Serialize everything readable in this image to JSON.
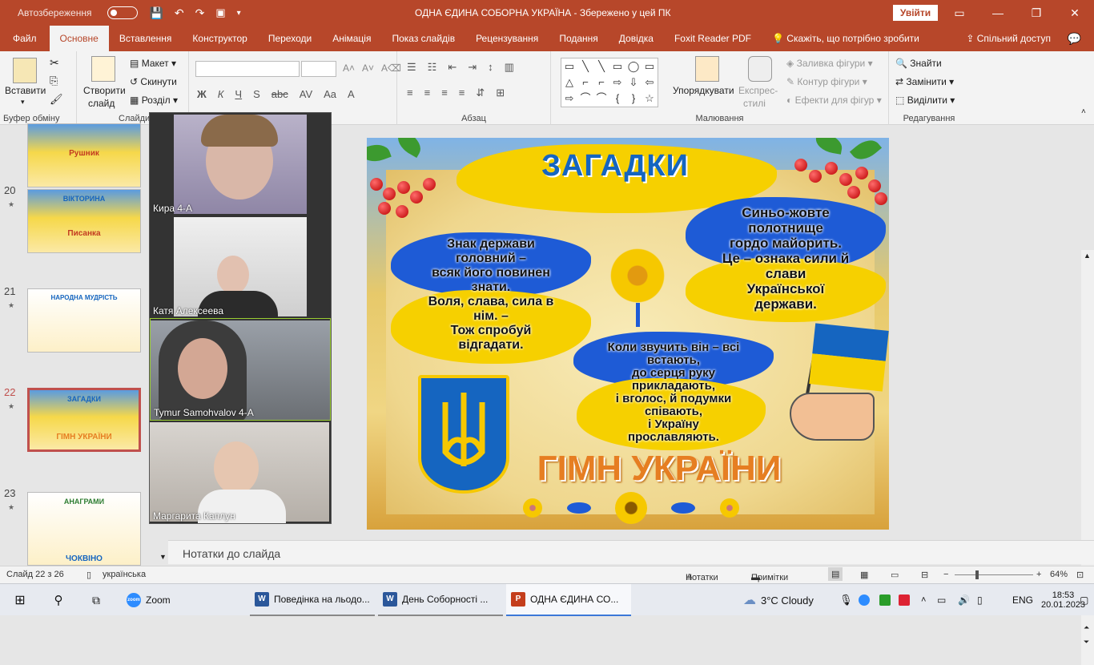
{
  "window": {
    "autosave": "Автозбереження",
    "title": "ОДНА ЄДИНА СОБОРНА УКРАЇНА  -  Збережено у цей ПК",
    "signin": "Увійти"
  },
  "tabs": [
    "Файл",
    "Основне",
    "Вставлення",
    "Конструктор",
    "Переходи",
    "Анімація",
    "Показ слайдів",
    "Рецензування",
    "Подання",
    "Довідка",
    "Foxit Reader PDF",
    "Скажіть, що потрібно зробити"
  ],
  "share": "Спільний доступ",
  "ribbon": {
    "paste": "Вставити",
    "clipboard": "Буфер обміну",
    "new_slide": "Створити",
    "new_slide2": "слайд",
    "layout": "Макет",
    "reset": "Скинути",
    "section": "Розділ",
    "slides": "Слайди",
    "paragraph": "Абзац",
    "arrange": "Упорядкувати",
    "styles": "Експрес-",
    "styles2": "стилі",
    "fill": "Заливка фігури",
    "outline": "Контур фігури",
    "effects": "Ефекти для фігур",
    "drawing": "Малювання",
    "find": "Знайти",
    "replace": "Замінити",
    "select": "Виділити",
    "editing": "Редагування",
    "bold": "Ж",
    "italic": "К",
    "underline": "Ч",
    "strike": "S",
    "abc": "abc",
    "av": "AV",
    "aa": "Aa",
    "fontcolor": "A",
    "shapes": [
      "▭",
      "╲",
      "╲",
      "▭",
      "◯",
      "▭",
      "△",
      "⌐",
      "⌐",
      "⇨",
      "⇩",
      "⇦",
      "⇨",
      "⌒",
      "⌒",
      "{",
      "}",
      "☆"
    ]
  },
  "thumbs": [
    {
      "num": "",
      "top_text": "",
      "bottom": "Рушник"
    },
    {
      "num": "20",
      "top_text": "ВІКТОРИНА",
      "bottom": "Писанка"
    },
    {
      "num": "21",
      "top_text": "НАРОДНА МУДРІСТЬ",
      "bottom": ""
    },
    {
      "num": "22",
      "top_text": "ЗАГАДКИ",
      "bottom": "ГІМН УКРАЇНИ"
    },
    {
      "num": "23",
      "top_text": "АНАГРАМИ",
      "bottom": "ЧОКВІНО"
    }
  ],
  "star": "★",
  "zoom": [
    "Кира 4-А",
    "Катя Алексеева",
    "Tymur Samohvalov 4-A",
    "Маргарита Каплун"
  ],
  "slide": {
    "title": "ЗАГАДКИ",
    "r1": [
      "Знак держави",
      "головний –",
      "всяк його повинен",
      "знати.",
      "Воля, слава, сила в",
      "нім. –",
      "Тож спробуй",
      "відгадати."
    ],
    "r2": [
      "Синьо-жовте",
      "полотнище",
      "гордо майорить.",
      "Це – ознака сили й",
      "слави",
      "Української",
      "держави."
    ],
    "r3": [
      "Коли звучить він – всі",
      "встають,",
      "до серця руку",
      "прикладають,",
      "і вголос, й подумки",
      "співають,",
      "і Україну",
      "прославляють."
    ],
    "hymn": "ГІМН УКРАЇНИ"
  },
  "notes": "Нотатки до слайда",
  "status": {
    "slide": "Слайд 22 з 26",
    "lang": "українська",
    "notes": "Нотатки",
    "comments": "Примітки",
    "zoom": "64%"
  },
  "taskbar": {
    "zoom": "Zoom",
    "w1": "Поведінка на льодо...",
    "w2": "День Соборності ...",
    "ppt": "ОДНА ЄДИНА СО...",
    "weather": "3°C  Cloudy",
    "lang": "ENG",
    "time": "18:53",
    "date": "20.01.2023"
  },
  "colors": {
    "accent": "#b7472a",
    "blue": "#1565c0",
    "yellow": "#f6d000",
    "orange": "#e67e22"
  }
}
